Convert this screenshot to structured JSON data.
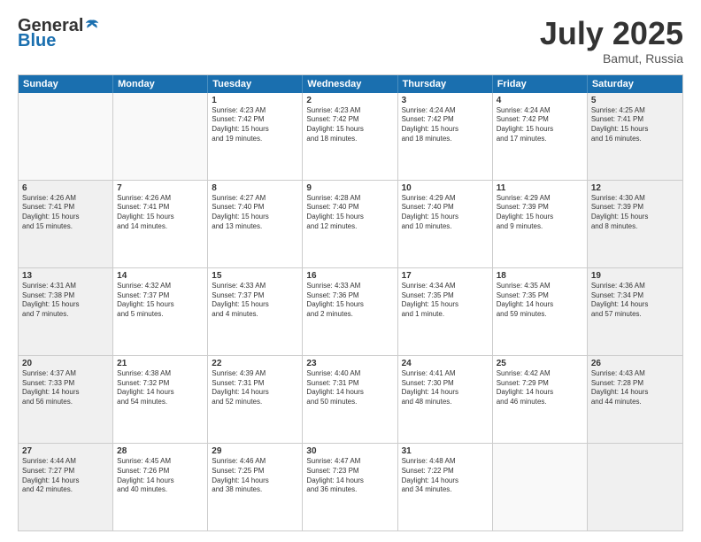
{
  "header": {
    "logo_general": "General",
    "logo_blue": "Blue",
    "month_year": "July 2025",
    "location": "Bamut, Russia"
  },
  "days_of_week": [
    "Sunday",
    "Monday",
    "Tuesday",
    "Wednesday",
    "Thursday",
    "Friday",
    "Saturday"
  ],
  "weeks": [
    [
      {
        "day": "",
        "text": "",
        "empty": true
      },
      {
        "day": "",
        "text": "",
        "empty": true
      },
      {
        "day": "1",
        "text": "Sunrise: 4:23 AM\nSunset: 7:42 PM\nDaylight: 15 hours\nand 19 minutes."
      },
      {
        "day": "2",
        "text": "Sunrise: 4:23 AM\nSunset: 7:42 PM\nDaylight: 15 hours\nand 18 minutes."
      },
      {
        "day": "3",
        "text": "Sunrise: 4:24 AM\nSunset: 7:42 PM\nDaylight: 15 hours\nand 18 minutes."
      },
      {
        "day": "4",
        "text": "Sunrise: 4:24 AM\nSunset: 7:42 PM\nDaylight: 15 hours\nand 17 minutes."
      },
      {
        "day": "5",
        "text": "Sunrise: 4:25 AM\nSunset: 7:41 PM\nDaylight: 15 hours\nand 16 minutes.",
        "shaded": true
      }
    ],
    [
      {
        "day": "6",
        "text": "Sunrise: 4:26 AM\nSunset: 7:41 PM\nDaylight: 15 hours\nand 15 minutes.",
        "shaded": true
      },
      {
        "day": "7",
        "text": "Sunrise: 4:26 AM\nSunset: 7:41 PM\nDaylight: 15 hours\nand 14 minutes."
      },
      {
        "day": "8",
        "text": "Sunrise: 4:27 AM\nSunset: 7:40 PM\nDaylight: 15 hours\nand 13 minutes."
      },
      {
        "day": "9",
        "text": "Sunrise: 4:28 AM\nSunset: 7:40 PM\nDaylight: 15 hours\nand 12 minutes."
      },
      {
        "day": "10",
        "text": "Sunrise: 4:29 AM\nSunset: 7:40 PM\nDaylight: 15 hours\nand 10 minutes."
      },
      {
        "day": "11",
        "text": "Sunrise: 4:29 AM\nSunset: 7:39 PM\nDaylight: 15 hours\nand 9 minutes."
      },
      {
        "day": "12",
        "text": "Sunrise: 4:30 AM\nSunset: 7:39 PM\nDaylight: 15 hours\nand 8 minutes.",
        "shaded": true
      }
    ],
    [
      {
        "day": "13",
        "text": "Sunrise: 4:31 AM\nSunset: 7:38 PM\nDaylight: 15 hours\nand 7 minutes.",
        "shaded": true
      },
      {
        "day": "14",
        "text": "Sunrise: 4:32 AM\nSunset: 7:37 PM\nDaylight: 15 hours\nand 5 minutes."
      },
      {
        "day": "15",
        "text": "Sunrise: 4:33 AM\nSunset: 7:37 PM\nDaylight: 15 hours\nand 4 minutes."
      },
      {
        "day": "16",
        "text": "Sunrise: 4:33 AM\nSunset: 7:36 PM\nDaylight: 15 hours\nand 2 minutes."
      },
      {
        "day": "17",
        "text": "Sunrise: 4:34 AM\nSunset: 7:35 PM\nDaylight: 15 hours\nand 1 minute."
      },
      {
        "day": "18",
        "text": "Sunrise: 4:35 AM\nSunset: 7:35 PM\nDaylight: 14 hours\nand 59 minutes."
      },
      {
        "day": "19",
        "text": "Sunrise: 4:36 AM\nSunset: 7:34 PM\nDaylight: 14 hours\nand 57 minutes.",
        "shaded": true
      }
    ],
    [
      {
        "day": "20",
        "text": "Sunrise: 4:37 AM\nSunset: 7:33 PM\nDaylight: 14 hours\nand 56 minutes.",
        "shaded": true
      },
      {
        "day": "21",
        "text": "Sunrise: 4:38 AM\nSunset: 7:32 PM\nDaylight: 14 hours\nand 54 minutes."
      },
      {
        "day": "22",
        "text": "Sunrise: 4:39 AM\nSunset: 7:31 PM\nDaylight: 14 hours\nand 52 minutes."
      },
      {
        "day": "23",
        "text": "Sunrise: 4:40 AM\nSunset: 7:31 PM\nDaylight: 14 hours\nand 50 minutes."
      },
      {
        "day": "24",
        "text": "Sunrise: 4:41 AM\nSunset: 7:30 PM\nDaylight: 14 hours\nand 48 minutes."
      },
      {
        "day": "25",
        "text": "Sunrise: 4:42 AM\nSunset: 7:29 PM\nDaylight: 14 hours\nand 46 minutes."
      },
      {
        "day": "26",
        "text": "Sunrise: 4:43 AM\nSunset: 7:28 PM\nDaylight: 14 hours\nand 44 minutes.",
        "shaded": true
      }
    ],
    [
      {
        "day": "27",
        "text": "Sunrise: 4:44 AM\nSunset: 7:27 PM\nDaylight: 14 hours\nand 42 minutes.",
        "shaded": true
      },
      {
        "day": "28",
        "text": "Sunrise: 4:45 AM\nSunset: 7:26 PM\nDaylight: 14 hours\nand 40 minutes."
      },
      {
        "day": "29",
        "text": "Sunrise: 4:46 AM\nSunset: 7:25 PM\nDaylight: 14 hours\nand 38 minutes."
      },
      {
        "day": "30",
        "text": "Sunrise: 4:47 AM\nSunset: 7:23 PM\nDaylight: 14 hours\nand 36 minutes."
      },
      {
        "day": "31",
        "text": "Sunrise: 4:48 AM\nSunset: 7:22 PM\nDaylight: 14 hours\nand 34 minutes."
      },
      {
        "day": "",
        "text": "",
        "empty": true
      },
      {
        "day": "",
        "text": "",
        "empty": true,
        "shaded": true
      }
    ]
  ]
}
